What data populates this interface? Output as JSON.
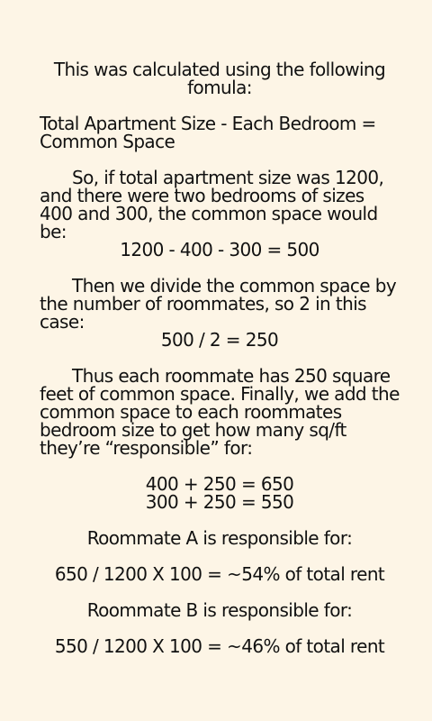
{
  "intro": {
    "line1": "This was calculated using the following",
    "line2": "fomula:"
  },
  "formula": {
    "line1": "Total Apartment Size - Each Bedroom =",
    "line2": "Common Space"
  },
  "example": {
    "text": "So, if total apartment size was 1200, and there were two bedrooms of sizes 400 and 300, the common space would be:",
    "equation": "1200 - 400 - 300 = 500"
  },
  "divide": {
    "text": "Then we divide the common space by the number of roommates, so 2 in this case:",
    "equation": "500 / 2 = 250"
  },
  "result": {
    "text": "Thus each roommate has 250 square feet of common space. Finally, we add the common space to each roommates bedroom size to get how many sq/ft they’re “responsible” for:",
    "equation_a": "400 + 250 = 650",
    "equation_b": "300 + 250 = 550"
  },
  "roommate_a": {
    "label": "Roommate A is responsible for:",
    "equation": "650 / 1200 X 100 = ~54% of total rent"
  },
  "roommate_b": {
    "label": "Roommate B is responsible for:",
    "equation": "550 / 1200 X 100 = ~46% of total rent"
  }
}
